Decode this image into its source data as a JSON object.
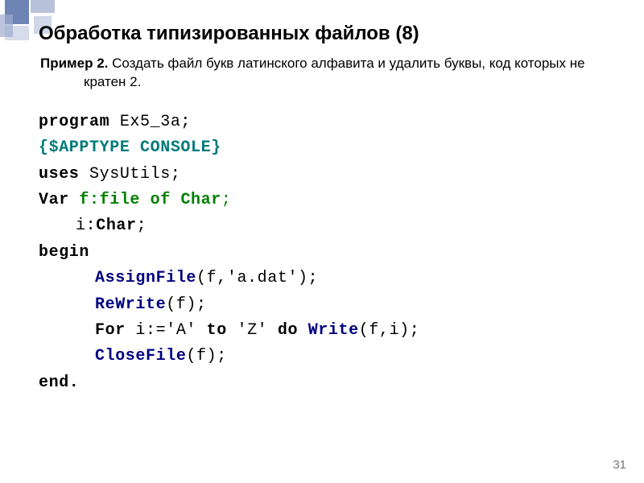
{
  "title": "Обработка типизированных файлов (8)",
  "example_label": "Пример 2.",
  "example_text": " Создать файл букв латинского алфавита и удалить буквы, код которых не кратен 2.",
  "code": {
    "l1a": "program",
    "l1b": " Ex5_3a;",
    "l2": "{$APPTYPE CONSOLE}",
    "l3a": "uses",
    "l3b": "  SysUtils;",
    "l4a": "Var ",
    "l4b": "f:file of Char",
    "l4c": ";",
    "l5a": "i:",
    "l5b": "Char",
    "l5c": ";",
    "l6": "begin",
    "l7a": "AssignFile",
    "l7b": "(f,'a.dat');",
    "l8a": "ReWrite",
    "l8b": "(f);",
    "l9a": "For",
    "l9b": " i:='A' ",
    "l9c": "to",
    "l9d": " 'Z' ",
    "l9e": "do",
    "l9f": " ",
    "l9g": "Write",
    "l9h": "(f,i);",
    "l10a": "CloseFile",
    "l10b": "(f);",
    "l11": "end."
  },
  "page_number": "31"
}
